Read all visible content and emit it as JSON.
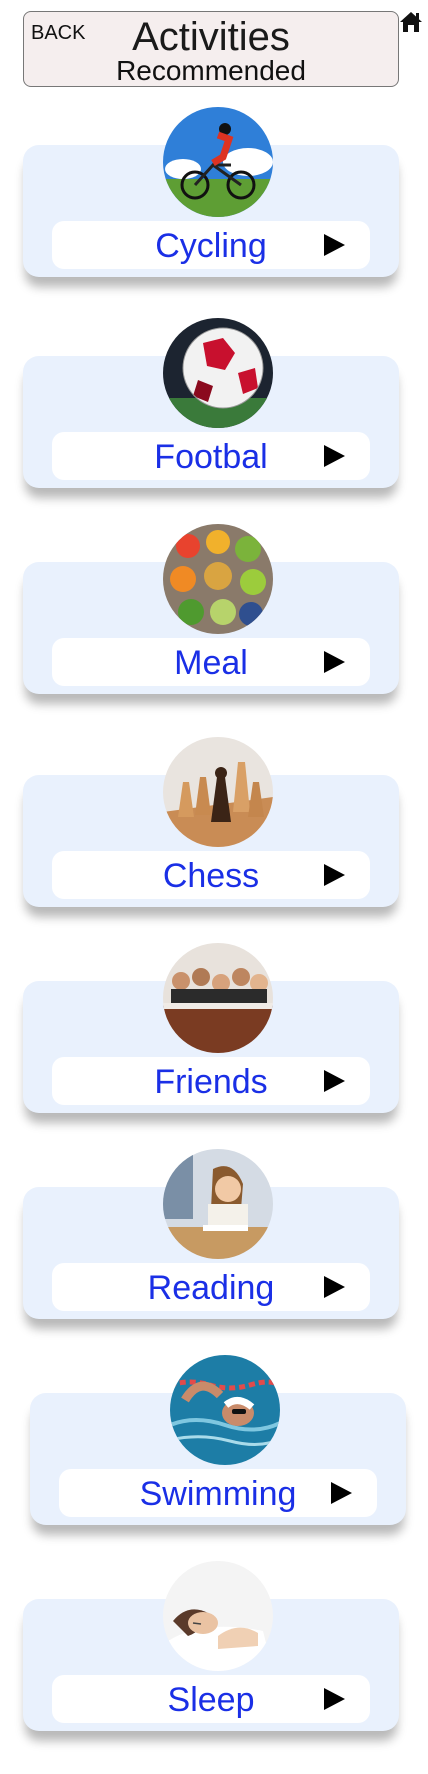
{
  "header": {
    "back_label": "BACK",
    "title": "Activities",
    "subtitle": "Recommended",
    "home_icon": "home-icon"
  },
  "activities": [
    {
      "label": "Cycling",
      "icon": "cycling-icon"
    },
    {
      "label": "Footbal",
      "icon": "football-icon"
    },
    {
      "label": "Meal",
      "icon": "meal-icon"
    },
    {
      "label": "Chess",
      "icon": "chess-icon"
    },
    {
      "label": "Friends",
      "icon": "friends-icon"
    },
    {
      "label": "Reading",
      "icon": "reading-icon"
    },
    {
      "label": "Swimming",
      "icon": "swimming-icon"
    },
    {
      "label": "Sleep",
      "icon": "sleep-icon"
    }
  ],
  "colors": {
    "card_background": "#e9f1fd",
    "label_text": "#1a2fe6",
    "header_background": "#f5eeee"
  }
}
